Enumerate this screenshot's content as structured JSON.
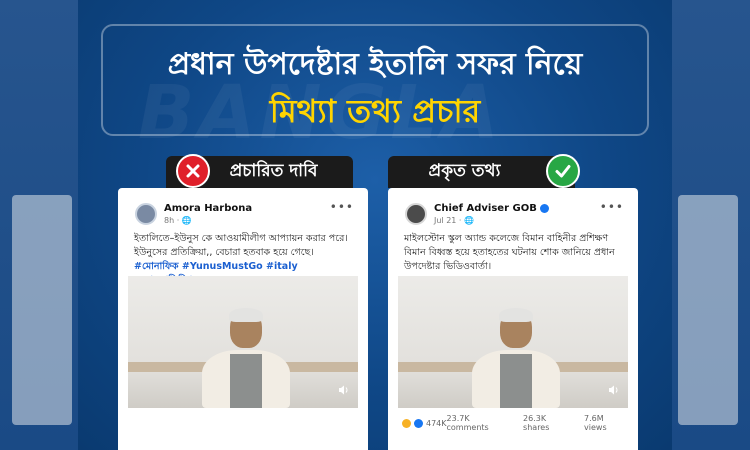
{
  "header": {
    "title_line1": "প্রধান উপদেষ্টার ইতালি সফর নিয়ে",
    "title_line2": "মিথ্যা তথ্য প্রচার",
    "watermark": "BANGLA"
  },
  "labels": {
    "claim": "প্রচারিত দাবি",
    "fact": "প্রকৃত তথ্য"
  },
  "colors": {
    "title_yellow": "#ffd400",
    "false_red": "#e0202a",
    "true_green": "#28a745",
    "hashtag_blue": "#1a5fd0"
  },
  "left_post": {
    "author": "Amora Harbona",
    "time": "8h · 🌐",
    "text": "ইতালিতে–ইউনুস কে আওয়ামীলীগ আপ্যায়ন করার পরে।\nইউনুসের প্রতিক্রিয়া,, বেচারা হতবাক হয়ে গেছে।",
    "hashtags": "#মোনাফিক #YunusMustGo #italy #আওয়ামীলীগ"
  },
  "right_post": {
    "author": "Chief Adviser GOB",
    "time": "Jul 21 · 🌐",
    "text": "মাইলস্টোন স্কুল অ্যান্ড কলেজে বিমান বাহিনীর প্রশিক্ষণ বিমান বিধ্বস্ত হয়ে হতাহতের ঘটনায় শোক জানিয়ে প্রধান উপদেষ্টার ভিডিওবার্তা।",
    "reactions": "474K",
    "comments": "23.7K comments",
    "shares": "26.3K shares",
    "views": "7.6M views"
  }
}
